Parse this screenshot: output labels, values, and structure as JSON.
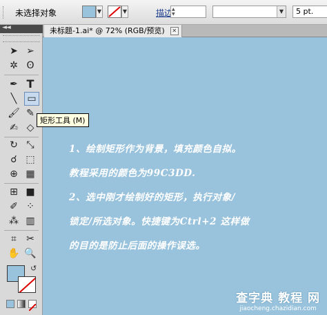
{
  "control_bar": {
    "selection_label": "未选择对象",
    "stroke_label": "描边:",
    "pt_value": "5 pt."
  },
  "colors": {
    "fill": "#99C3DD",
    "canvas": "#99C3DD"
  },
  "document": {
    "tab_title": "未标题-1.ai* @ 72% (RGB/预览)"
  },
  "tooltip": "矩形工具 (M)",
  "content_lines": [
    "1、绘制矩形作为背景，填充颜色自拟。",
    "教程采用的颜色为99C3DD.",
    "2、选中刚才绘制好的矩形，执行对象/",
    "锁定/所选对象。快捷键为Ctrl+2  这样做",
    "的目的是防止后面的操作误选。"
  ],
  "watermark": {
    "title": "查字典 教程 网",
    "url": "jiaocheng.chazidian.com"
  },
  "icons": {
    "tools": [
      "selection-tool-icon",
      "direct-selection-tool-icon",
      "magic-wand-tool-icon",
      "lasso-tool-icon",
      "pen-tool-icon",
      "type-tool-icon",
      "line-segment-tool-icon",
      "rectangle-tool-icon",
      "paintbrush-tool-icon",
      "pencil-tool-icon",
      "blob-brush-tool-icon",
      "eraser-tool-icon",
      "rotate-tool-icon",
      "scale-tool-icon",
      "warp-tool-icon",
      "free-transform-tool-icon",
      "shape-builder-tool-icon",
      "perspective-grid-tool-icon",
      "mesh-tool-icon",
      "gradient-tool-icon",
      "eyedropper-tool-icon",
      "blend-tool-icon",
      "symbol-sprayer-tool-icon",
      "column-graph-tool-icon",
      "artboard-tool-icon",
      "slice-tool-icon",
      "hand-tool-icon",
      "zoom-tool-icon"
    ]
  }
}
